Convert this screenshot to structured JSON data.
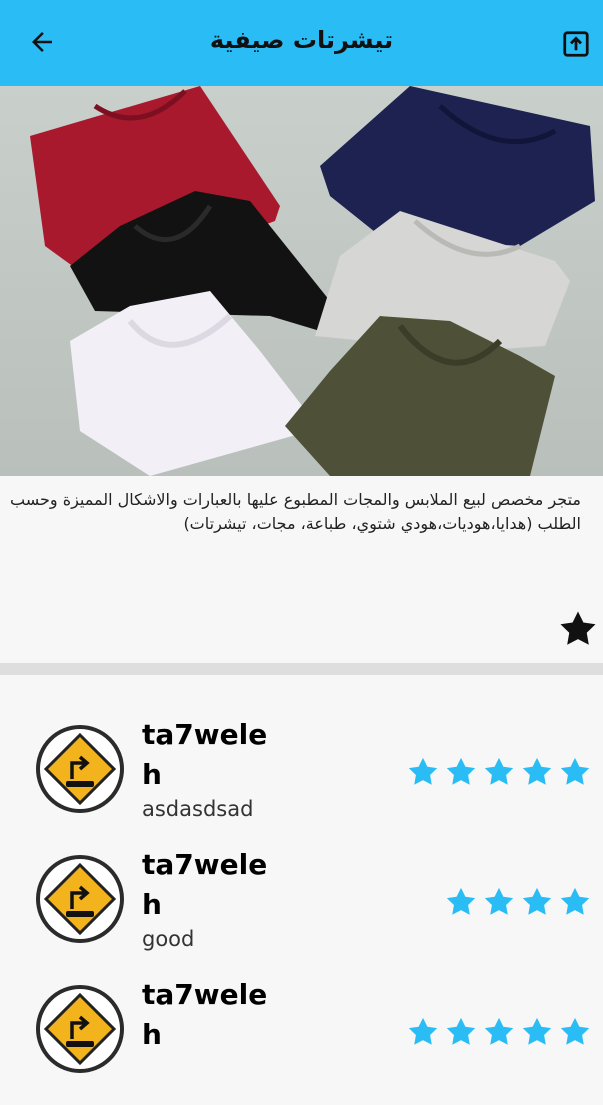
{
  "appbar": {
    "title": "تيشرتات صيفية",
    "back_icon": "arrow-back-icon",
    "share_icon": "share-icon"
  },
  "hero": {
    "image_name": "folded-tshirts-photo",
    "shirts": [
      "red",
      "navy",
      "black",
      "light-gray",
      "white",
      "olive"
    ]
  },
  "description": "متجر مخصص لبيع الملابس والمجات المطبوع عليها بالعبارات والاشكال المميزة وحسب الطلب (هدايا،هوديات،هودي شتوي، طباعة، مجات، تيشرتات)",
  "favorite_icon": "star-icon",
  "reviews": [
    {
      "user": "ta7weleh",
      "comment": "asdasdsad",
      "stars": 5
    },
    {
      "user": "ta7weleh",
      "comment": "good",
      "stars": 4
    },
    {
      "user": "ta7weleh",
      "comment": "",
      "stars": 5
    }
  ],
  "colors": {
    "appbar": "#29bcf5",
    "star": "#29bcf5",
    "fav_star": "#111111"
  }
}
